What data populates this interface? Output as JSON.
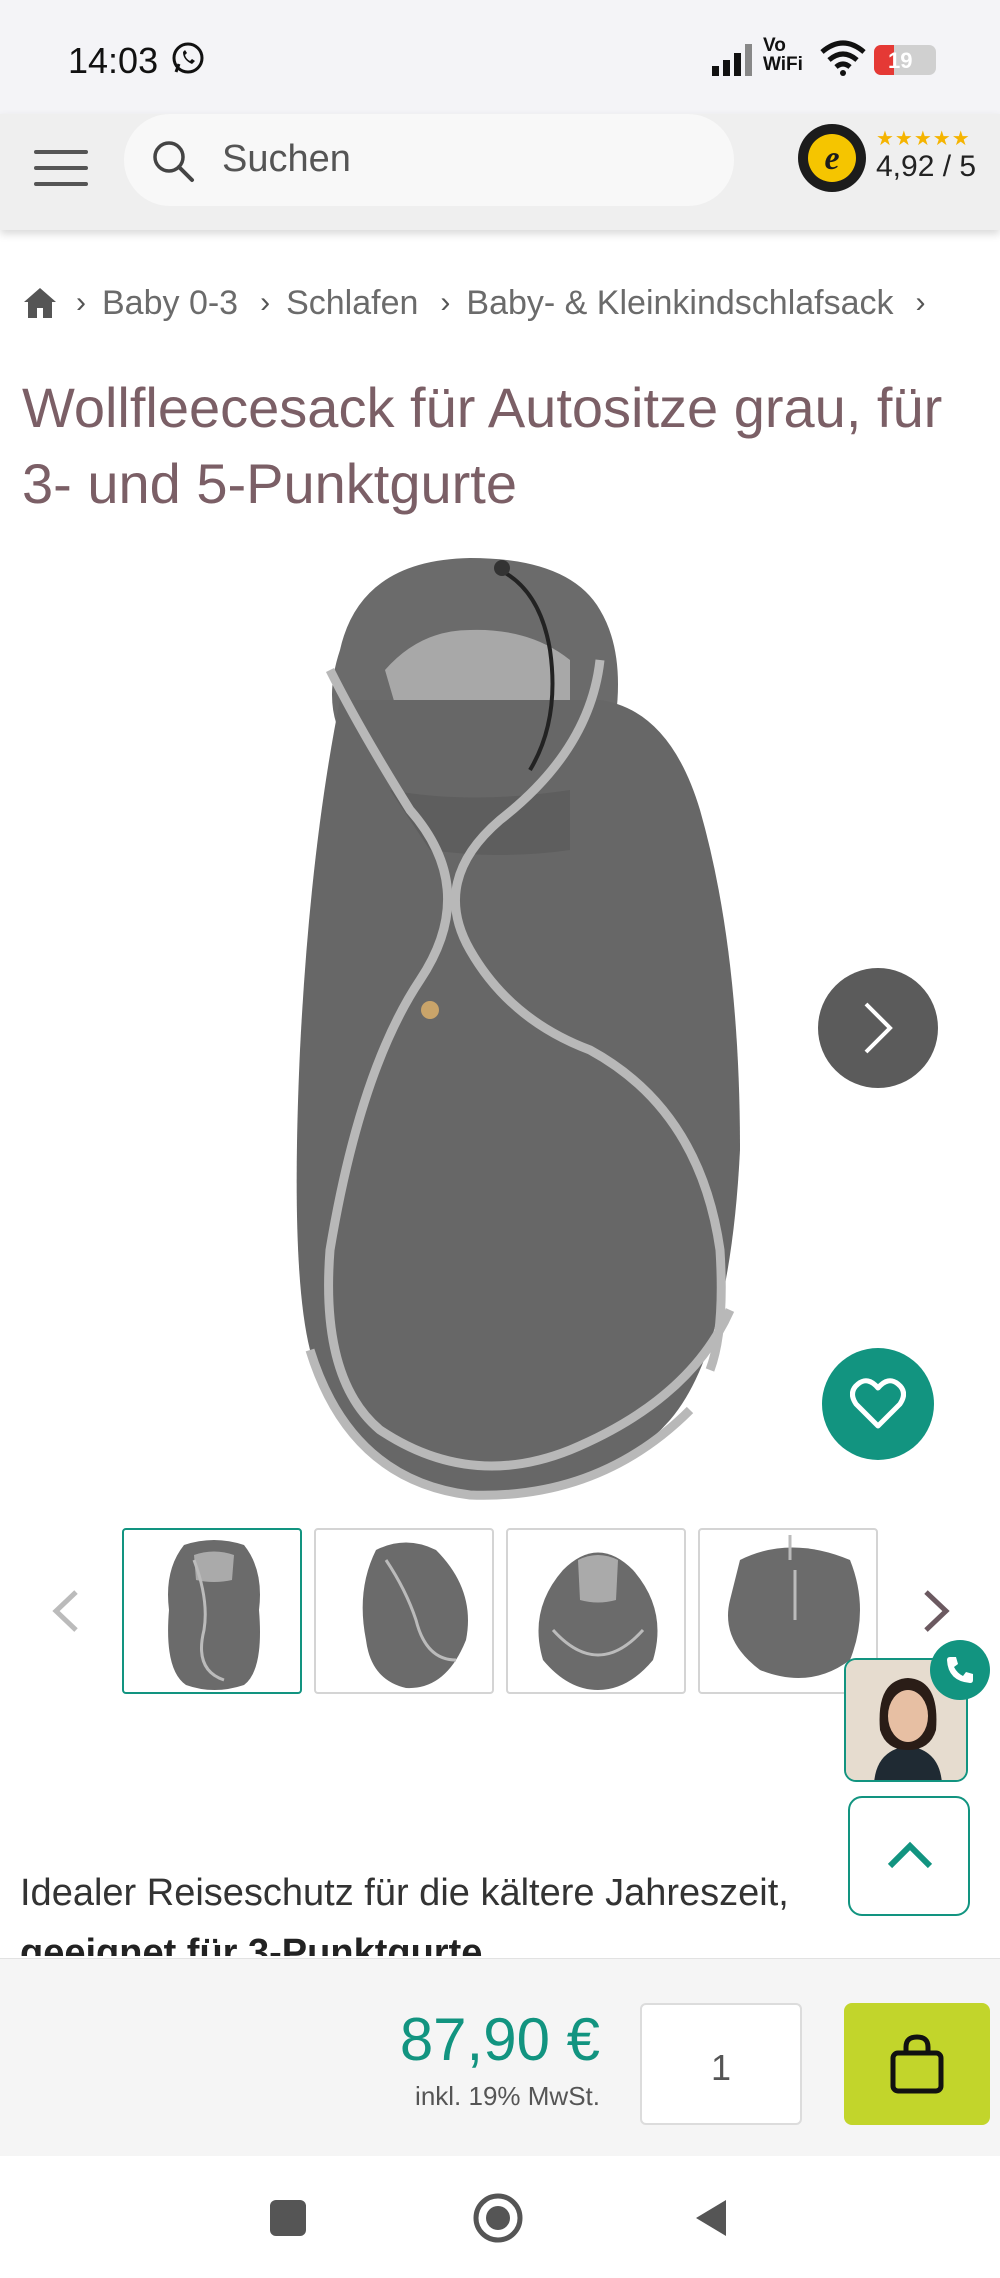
{
  "status_bar": {
    "time": "14:03",
    "vowifi": "Vo\nWiFi",
    "battery": "19"
  },
  "header": {
    "search_placeholder": "Suchen",
    "rating_stars": "★★★★★",
    "rating_score": "4,92 / 5"
  },
  "breadcrumb": [
    "Baby 0-3",
    "Schlafen",
    "Baby- & Kleinkindschlafsack"
  ],
  "product": {
    "title": "Wollfleecesack für Autositze grau, für 3- und 5-Punktgurte",
    "description": "Idealer Reiseschutz für die kältere Jahreszeit,",
    "description_2": "geeignet für 3-Punktgurte",
    "price": "87,90 €",
    "vat_note": "inkl. 19% MwSt.",
    "quantity": "1"
  },
  "colors": {
    "accent": "#129480",
    "title": "#7b5f66",
    "cart": "#c2d52b"
  },
  "icons": [
    "whatsapp-icon",
    "signal-icon",
    "wifi-icon",
    "menu-icon",
    "search-icon",
    "trusted-shops-icon",
    "home-icon",
    "chevron-right-icon",
    "heart-icon",
    "chevron-left-icon",
    "phone-icon",
    "chevron-up-icon",
    "shopping-bag-icon"
  ]
}
